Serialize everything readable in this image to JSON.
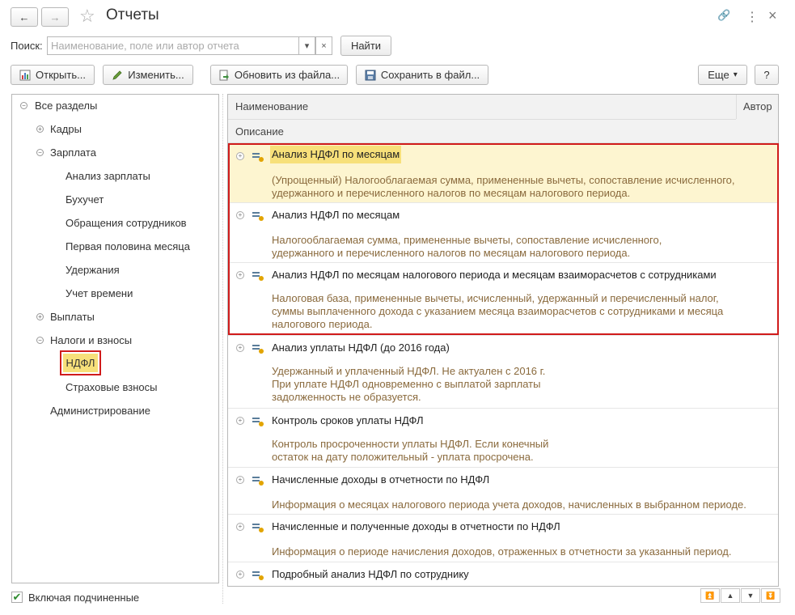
{
  "header": {
    "title": "Отчеты",
    "back_icon": "←",
    "forward_icon": "→",
    "star_icon": "☆",
    "link_icon": "🔗",
    "menu_icon": "⋮",
    "close_icon": "×"
  },
  "search": {
    "label": "Поиск:",
    "placeholder": "Наименование, поле или автор отчета",
    "dropdown_icon": "▾",
    "clear_icon": "×",
    "find_label": "Найти"
  },
  "toolbar": {
    "open_label": "Открыть...",
    "edit_label": "Изменить...",
    "update_label": "Обновить из файла...",
    "save_label": "Сохранить в файл...",
    "more_label": "Еще",
    "more_arrow": "▾",
    "help_label": "?"
  },
  "tree": {
    "root": "Все разделы",
    "kadry": "Кадры",
    "zarplata": "Зарплата",
    "zarplata_items": [
      "Анализ зарплаты",
      "Бухучет",
      "Обращения сотрудников",
      "Первая половина месяца",
      "Удержания",
      "Учет времени"
    ],
    "vyplaty": "Выплаты",
    "nalogi": "Налоги и взносы",
    "ndfl": "НДФЛ",
    "strakh": "Страховые взносы",
    "admin": "Администрирование"
  },
  "grid": {
    "col_name": "Наименование",
    "col_author": "Автор",
    "col_desc": "Описание",
    "rows": [
      {
        "title": "Анализ НДФЛ по месяцам",
        "desc": "(Упрощенный) Налогооблагаемая сумма, примененные вычеты, сопоставление исчисленного,\nудержанного и перечисленного налогов по месяцам налогового периода."
      },
      {
        "title": "Анализ НДФЛ по месяцам",
        "desc": "Налогооблагаемая сумма, примененные вычеты, сопоставление исчисленного,\nудержанного и перечисленного налогов по месяцам налогового периода."
      },
      {
        "title": "Анализ НДФЛ по месяцам налогового периода и месяцам взаиморасчетов с сотрудниками",
        "desc": "Налоговая база, примененные вычеты, исчисленный, удержанный и перечисленный налог,\nсуммы выплаченного дохода с указанием месяца взаиморасчетов с сотрудниками и месяца\nналогового периода."
      },
      {
        "title": "Анализ уплаты НДФЛ (до 2016 года)",
        "desc": "Удержанный и уплаченный НДФЛ. Не актуален с 2016 г.\nПри уплате НДФЛ одновременно с выплатой зарплаты\nзадолженность не образуется."
      },
      {
        "title": "Контроль сроков уплаты НДФЛ",
        "desc": "Контроль просроченности уплаты НДФЛ. Если конечный\nостаток на дату положительный - уплата просрочена."
      },
      {
        "title": "Начисленные доходы в отчетности по НДФЛ",
        "desc": "Информация о месяцах налогового периода учета доходов, начисленных в выбранном периоде."
      },
      {
        "title": "Начисленные и полученные доходы в отчетности по НДФЛ",
        "desc": "Информация о периоде начисления доходов, отраженных в отчетности за указанный период."
      },
      {
        "title": "Подробный анализ НДФЛ по сотруднику",
        "desc": ""
      }
    ]
  },
  "footer": {
    "include_sub_label": "Включая подчиненные",
    "check_mark": "✔",
    "nav_buttons": [
      "⏫",
      "▲",
      "▼",
      "⏬"
    ]
  }
}
